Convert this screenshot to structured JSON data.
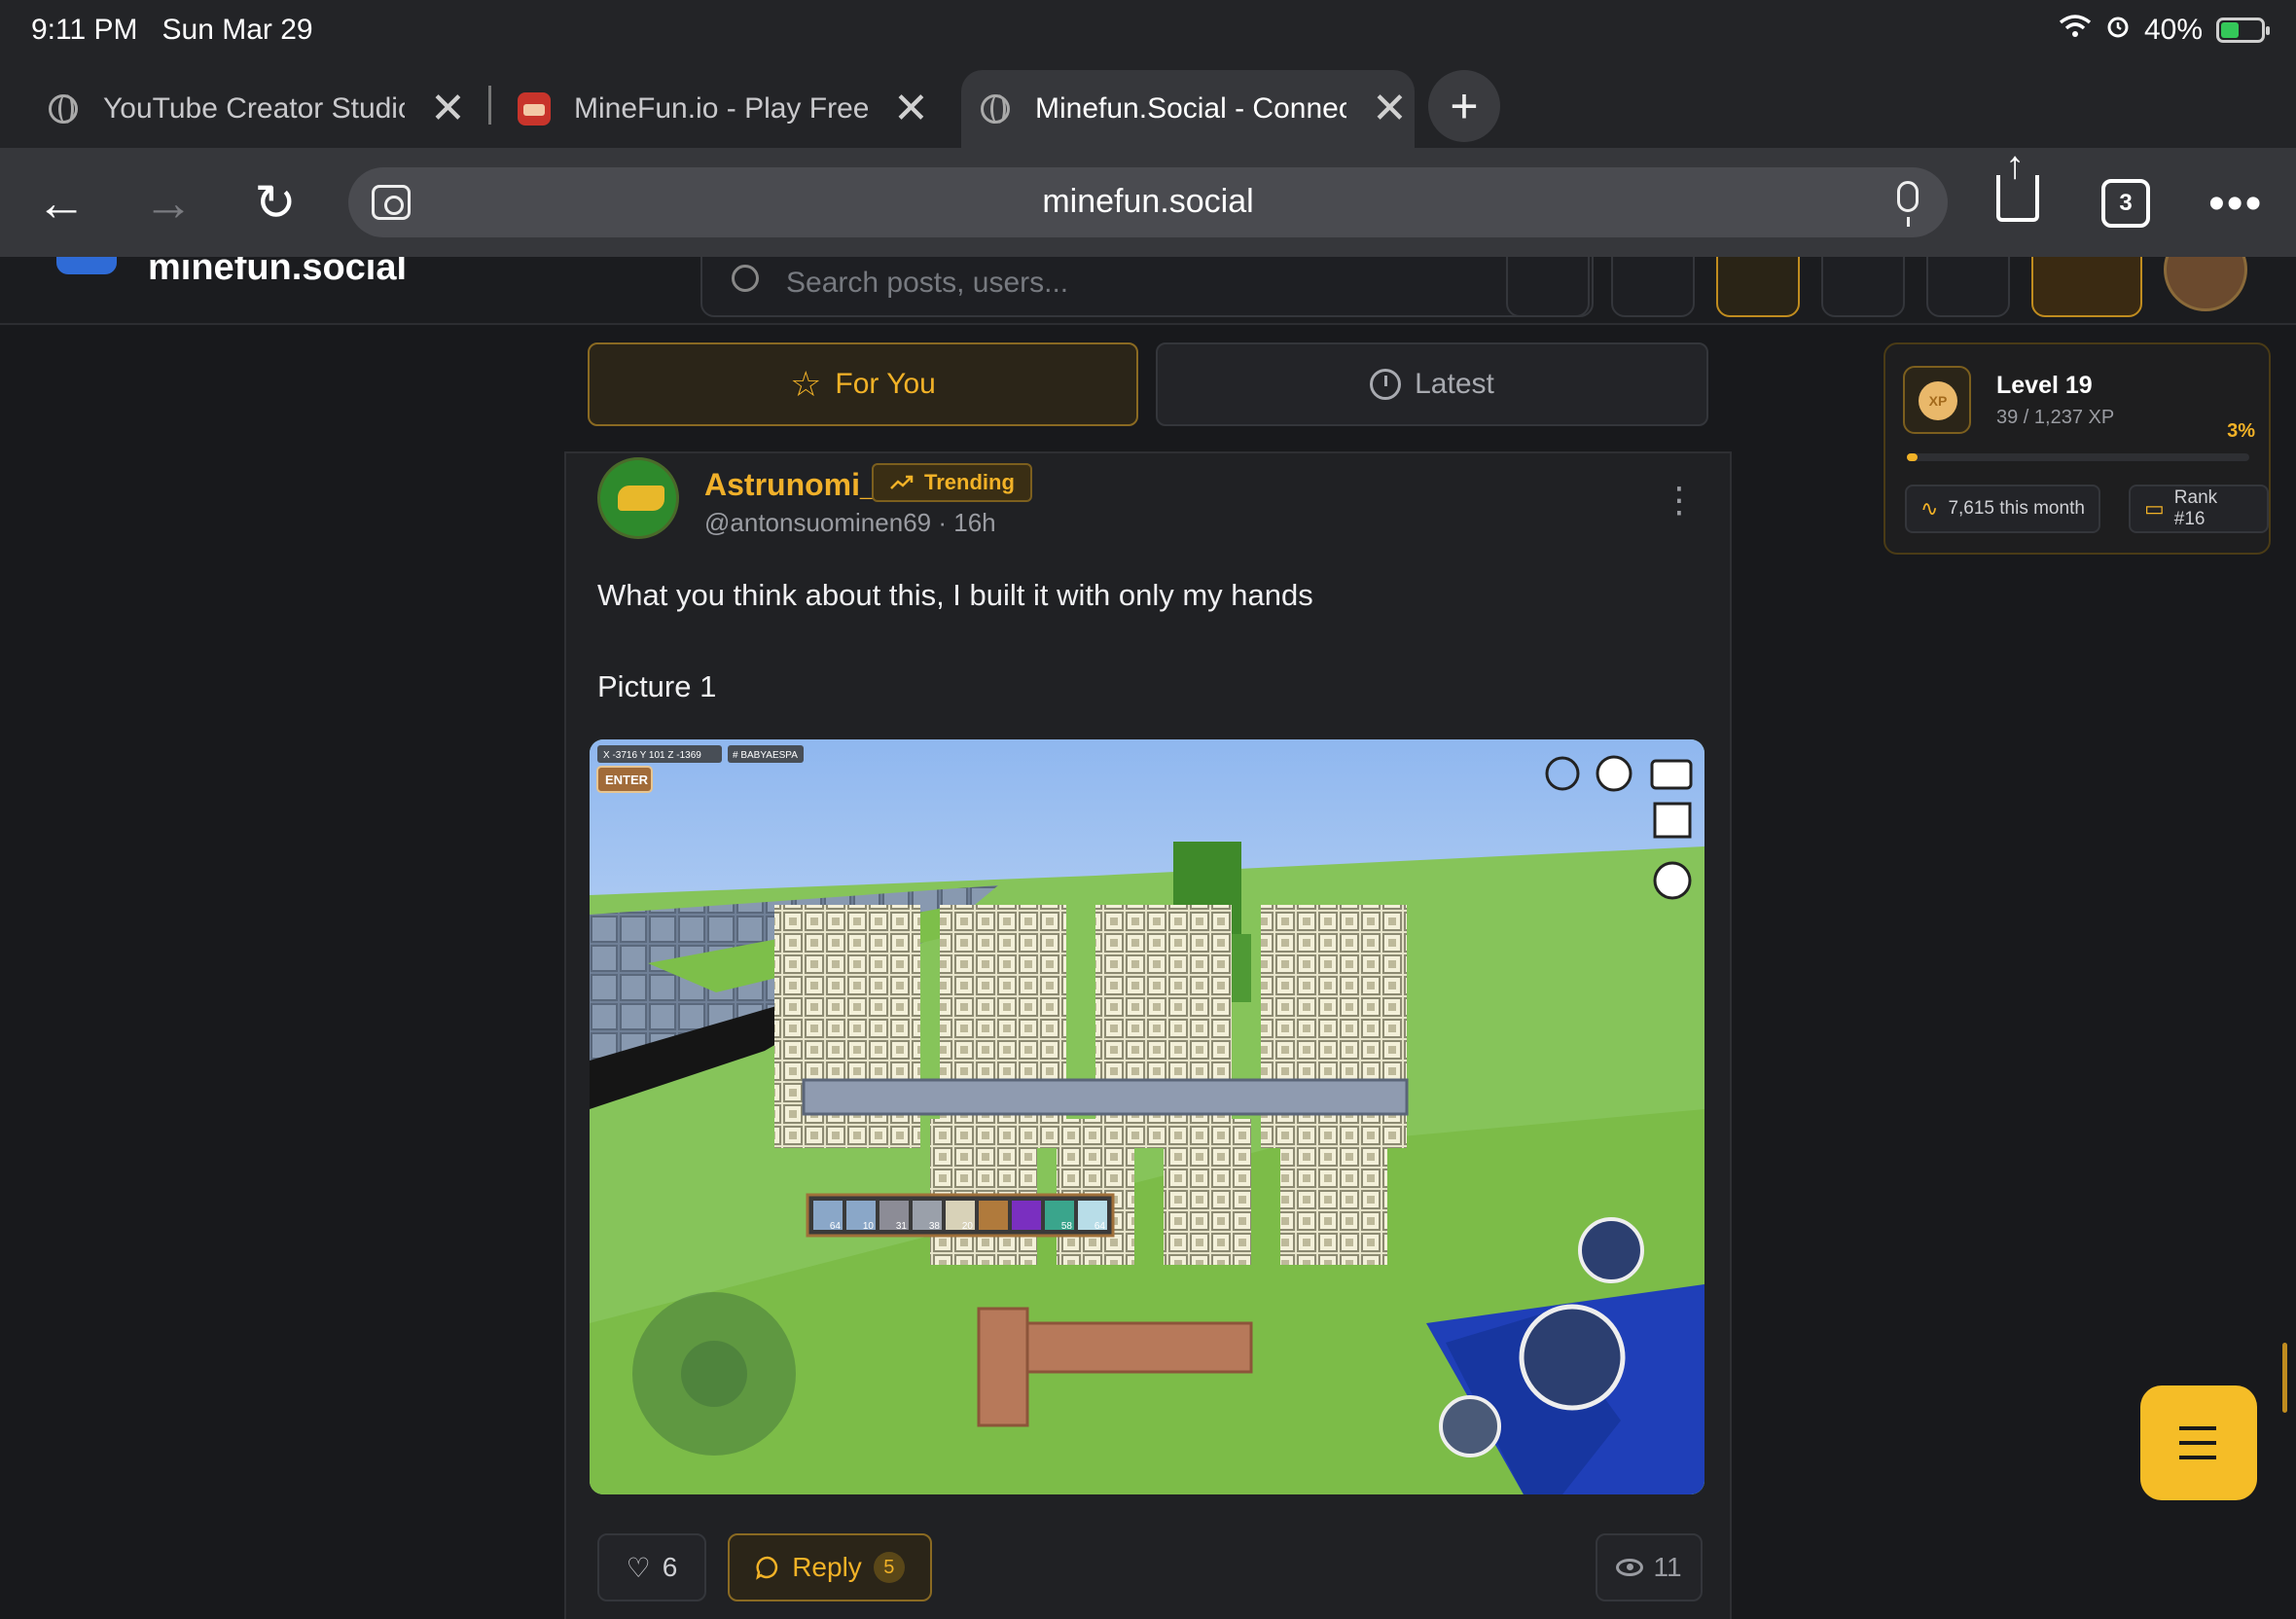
{
  "status_bar": {
    "time": "9:11 PM",
    "date": "Sun Mar 29",
    "battery": "40%"
  },
  "browser": {
    "tabs": [
      {
        "title": "YouTube Creator Studio",
        "active": false
      },
      {
        "title": "MineFun.io - Play Free Online Games",
        "active": false
      },
      {
        "title": "Minefun.Social - Connect",
        "active": true
      }
    ],
    "url": "minefun.social",
    "tab_count": "3"
  },
  "site": {
    "name": "minefun.social",
    "search_placeholder": "Search posts, users..."
  },
  "feed": {
    "tabs": [
      {
        "label": "For You",
        "active": true
      },
      {
        "label": "Latest",
        "active": false
      }
    ]
  },
  "post": {
    "author": "Astrunomi_",
    "badge": "Trending",
    "handle": "@antonsuominen69",
    "time": "16h",
    "text": "What you think about this, I built it with only my hands",
    "text2": "Picture 1",
    "likes": "6",
    "reply_label": "Reply",
    "reply_count": "5",
    "views": "11",
    "image": {
      "hud_coords": "X -3716  Y 101  Z -1369",
      "hud_tag": "# BABYAESPA",
      "enter_label": "ENTER",
      "hotbar": [
        "64",
        "10",
        "31",
        "38",
        "20",
        "",
        "",
        "58",
        "64"
      ]
    }
  },
  "level_card": {
    "level": "Level 19",
    "xp": "39 / 1,237 XP",
    "progress_pct": "3%",
    "progress_fraction": 0.03,
    "month": "7,615 this month",
    "rank": "Rank #16"
  },
  "colors": {
    "accent": "#f2b227",
    "background": "#18191c",
    "card": "#202124"
  }
}
